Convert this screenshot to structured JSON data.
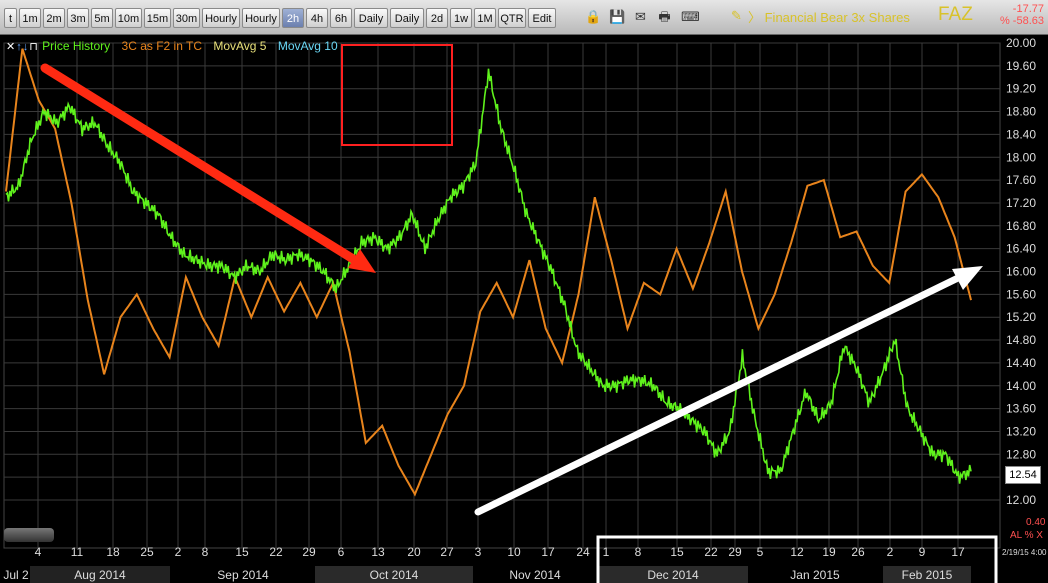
{
  "toolbar": {
    "buttons": [
      "t",
      "1m",
      "2m",
      "3m",
      "5m",
      "10m",
      "15m",
      "30m",
      "Hourly",
      "Hourly",
      "2h",
      "4h",
      "6h",
      "Daily",
      "Daily",
      "2d",
      "1w",
      "1M",
      "QTR",
      "Edit"
    ],
    "active": "2h"
  },
  "header": {
    "title": "〉 Financial Bear 3x Shares",
    "ticker": "FAZ",
    "change": "-17.77",
    "change_pct": "% -58.63"
  },
  "legend": {
    "price": "Price History",
    "indicator": "3C as F2 in TC",
    "ma5": "MovAvg 5",
    "ma10": "MovAvg 10"
  },
  "last_price": "12.54",
  "right_low_label": "0.40",
  "right_pct_label": "AL % X",
  "timestamp": "2/19/15 4:00",
  "colors": {
    "price": "#5ff21c",
    "indicator": "#e8841c",
    "ma5": "#e8e07a",
    "ma10": "#6ad7f5",
    "arrow_red": "#ff2a12",
    "arrow_white": "#ffffff",
    "box": "#ff2020"
  },
  "chart_data": {
    "type": "line",
    "ylim": [
      12.0,
      20.0
    ],
    "yticks": [
      "12.00",
      "12.40",
      "12.80",
      "13.20",
      "13.60",
      "14.00",
      "14.40",
      "14.80",
      "15.20",
      "15.60",
      "16.00",
      "16.40",
      "16.80",
      "17.20",
      "17.60",
      "18.00",
      "18.40",
      "18.80",
      "19.20",
      "19.60",
      "20.00"
    ],
    "xticks": [
      "4",
      "11",
      "18",
      "25",
      "2",
      "8",
      "15",
      "22",
      "29",
      "6",
      "13",
      "20",
      "27",
      "3",
      "10",
      "17",
      "24",
      "1",
      "8",
      "15",
      "22",
      "29",
      "5",
      "12",
      "19",
      "26",
      "2",
      "9",
      "17"
    ],
    "months": [
      "Jul 2",
      "Aug 2014",
      "Sep 2014",
      "Oct 2014",
      "Nov 2014",
      "Dec 2014",
      "Jan 2015",
      "Feb 2015"
    ],
    "series": [
      {
        "name": "Price History",
        "values": [
          17.3,
          17.5,
          18.3,
          18.8,
          18.6,
          18.9,
          18.5,
          18.6,
          18.2,
          17.9,
          17.4,
          17.2,
          17.0,
          16.6,
          16.3,
          16.2,
          16.1,
          16.1,
          15.9,
          16.1,
          16.0,
          16.3,
          16.2,
          16.3,
          16.2,
          16.0,
          15.7,
          16.1,
          16.5,
          16.6,
          16.4,
          16.6,
          17.0,
          16.4,
          16.9,
          17.3,
          17.5,
          17.9,
          19.5,
          18.5,
          17.8,
          17.0,
          16.5,
          16.0,
          15.4,
          14.6,
          14.3,
          14.0,
          14.0,
          14.1,
          14.1,
          14.0,
          13.7,
          13.6,
          13.4,
          13.2,
          12.8,
          13.2,
          14.5,
          13.4,
          12.5,
          12.5,
          13.2,
          13.9,
          13.4,
          13.7,
          14.7,
          14.3,
          13.7,
          14.2,
          14.8,
          13.6,
          13.2,
          12.8,
          12.8,
          12.4,
          12.5
        ]
      },
      {
        "name": "3C as F2 in TC",
        "values": [
          17.4,
          19.9,
          19.0,
          18.5,
          17.2,
          15.5,
          14.2,
          15.2,
          15.6,
          15.0,
          14.5,
          15.9,
          15.2,
          14.7,
          15.9,
          15.2,
          15.9,
          15.3,
          15.8,
          15.2,
          15.8,
          14.6,
          13.0,
          13.3,
          12.6,
          12.1,
          12.8,
          13.5,
          14.0,
          15.3,
          15.8,
          15.2,
          16.2,
          15.0,
          14.4,
          15.6,
          17.3,
          16.2,
          15.0,
          15.8,
          15.6,
          16.4,
          15.7,
          16.5,
          17.4,
          16.0,
          15.0,
          15.6,
          16.5,
          17.5,
          17.6,
          16.6,
          16.7,
          16.1,
          15.8,
          17.4,
          17.7,
          17.3,
          16.6,
          15.5
        ]
      }
    ]
  }
}
